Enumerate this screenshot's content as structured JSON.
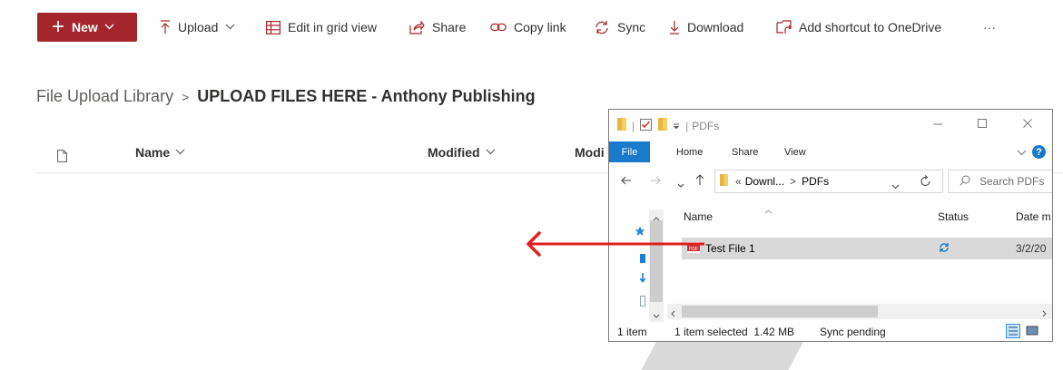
{
  "toolbar": {
    "new_label": "New",
    "upload_label": "Upload",
    "edit_grid_label": "Edit in grid view",
    "share_label": "Share",
    "copy_link_label": "Copy link",
    "sync_label": "Sync",
    "download_label": "Download",
    "shortcut_label": "Add shortcut to OneDrive",
    "more_label": "···"
  },
  "breadcrumb": {
    "root": "File Upload Library",
    "separator": ">",
    "current": "UPLOAD FILES HERE - Anthony Publishing"
  },
  "list": {
    "columns": {
      "name": "Name",
      "modified": "Modified",
      "modified_by": "Modi"
    }
  },
  "explorer": {
    "title": "PDFs",
    "ribbon_tabs": {
      "file": "File",
      "home": "Home",
      "share": "Share",
      "view": "View"
    },
    "help": "?",
    "address": {
      "prefix": "«",
      "part1": "Downl...",
      "arrow": ">",
      "part2": "PDFs"
    },
    "search_placeholder": "Search PDFs",
    "columns": {
      "name": "Name",
      "status": "Status",
      "date": "Date m"
    },
    "files": [
      {
        "name": "Test File 1",
        "date": "3/2/20"
      }
    ],
    "statusbar": {
      "count": "1 item",
      "selected": "1 item selected  1.42 MB",
      "sync": "Sync pending"
    }
  },
  "colors": {
    "accent": "#a4262c",
    "drag_arrow": "#e02020",
    "explorer_blue": "#1979ca"
  }
}
